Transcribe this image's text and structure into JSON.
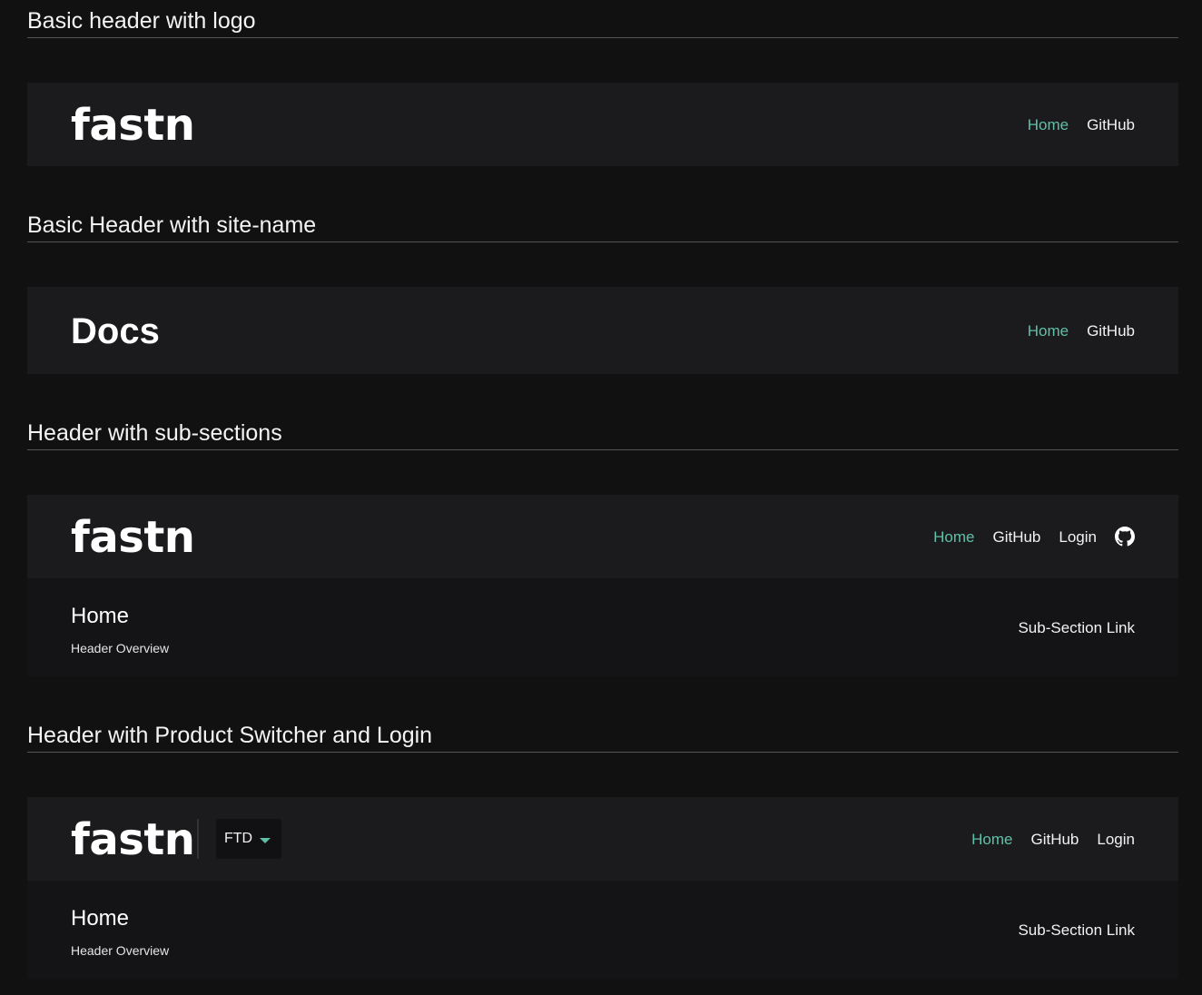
{
  "sections": [
    {
      "title": "Basic header with logo",
      "header": {
        "logo": "fastn",
        "nav": [
          "Home",
          "GitHub"
        ]
      }
    },
    {
      "title": "Basic Header with site-name",
      "header": {
        "site_name": "Docs",
        "nav": [
          "Home",
          "GitHub"
        ]
      }
    },
    {
      "title": "Header with sub-sections",
      "header": {
        "logo": "fastn",
        "nav": [
          "Home",
          "GitHub",
          "Login"
        ],
        "icon": "github-icon"
      },
      "subsection": {
        "title": "Home",
        "caption": "Header Overview",
        "link": "Sub-Section Link"
      }
    },
    {
      "title": "Header with Product Switcher and Login",
      "header": {
        "logo": "fastn",
        "switcher": {
          "value": "FTD",
          "icon": "caret-down-icon"
        },
        "nav": [
          "Home",
          "GitHub",
          "Login"
        ]
      },
      "subsection": {
        "title": "Home",
        "caption": "Header Overview",
        "link": "Sub-Section Link"
      }
    }
  ],
  "colors": {
    "background": "#111112",
    "header_bg": "#1b1b1e",
    "subheader_bg": "#141416",
    "accent": "#5fc0a7",
    "text": "#f2f2f2",
    "divider": "#545454"
  }
}
